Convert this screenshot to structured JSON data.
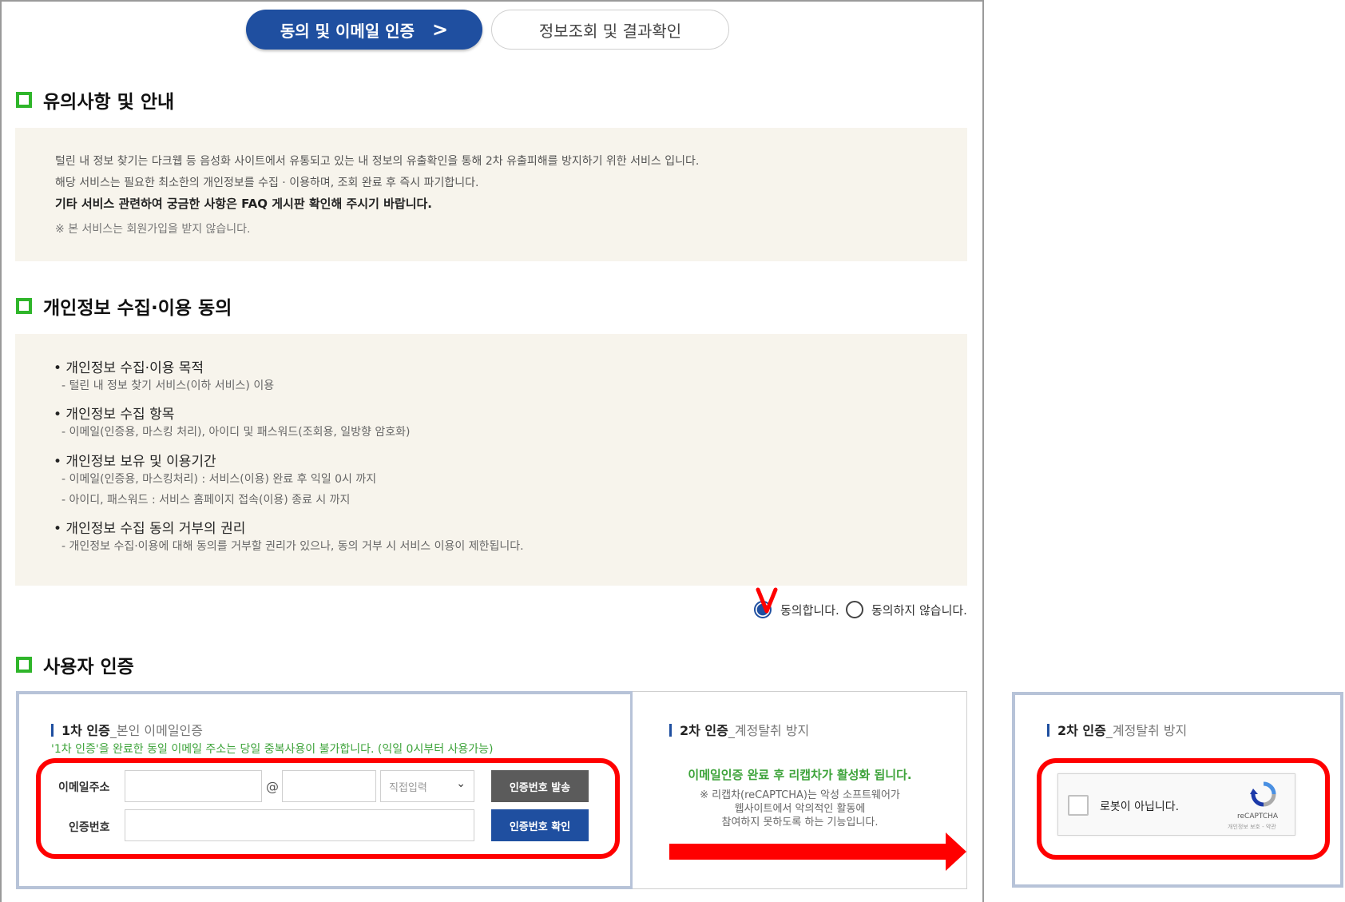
{
  "steps": {
    "active_label": "동의 및 이메일 인증",
    "inactive_label": "정보조회 및 결과확인"
  },
  "notice": {
    "title": "유의사항 및 안내",
    "line1": "털린 내 정보 찾기는 다크웹 등 음성화 사이트에서 유통되고 있는 내 정보의 유출확인을 통해 2차 유출피해를 방지하기 위한 서비스 입니다.",
    "line2": "해당 서비스는 필요한 최소한의 개인정보를 수집 · 이용하며, 조회 완료 후 즉시 파기합니다.",
    "line3": "기타 서비스 관련하여 궁금한 사항은 FAQ 게시판 확인해 주시기 바랍니다.",
    "line4": "※ 본 서비스는 회원가입을 받지 않습니다."
  },
  "privacy": {
    "title": "개인정보 수집·이용 동의",
    "items": [
      {
        "title": "• 개인정보 수집·이용 목적",
        "subs": [
          "- 털린 내 정보 찾기 서비스(이하 서비스) 이용"
        ]
      },
      {
        "title": "• 개인정보 수집 항목",
        "subs": [
          "- 이메일(인증용, 마스킹 처리), 아이디 및 패스워드(조회용, 일방향 암호화)"
        ]
      },
      {
        "title": "• 개인정보 보유 및 이용기간",
        "subs": [
          "- 이메일(인증용, 마스킹처리) : 서비스(이용) 완료 후 익일 0시 까지",
          "- 아이디, 패스워드 : 서비스 홈페이지 접속(이용) 종료 시 까지"
        ]
      },
      {
        "title": "• 개인정보 수집 동의 거부의 권리",
        "subs": [
          "- 개인정보 수집·이용에 대해 동의를 거부할 권리가 있으나, 동의 거부 시 서비스 이용이 제한됩니다."
        ]
      }
    ],
    "agree_label": "동의합니다.",
    "disagree_label": "동의하지 않습니다.",
    "selected": "agree"
  },
  "auth": {
    "title": "사용자 인증",
    "first": {
      "head_bold": "1차 인증",
      "head_light": "_본인 이메일인증",
      "note": "'1차 인증'을 완료한 동일 이메일 주소는 당일 중복사용이 불가합니다. (익일 0시부터 사용가능)",
      "email_label": "이메일주소",
      "at": "@",
      "email_user_value": "",
      "email_domain_value": "",
      "domain_select": "직접입력",
      "send_button": "인증번호 발송",
      "code_label": "인증번호",
      "code_value": "",
      "confirm_button": "인증번호 확인"
    },
    "second": {
      "head_bold": "2차 인증",
      "head_light": "_계정탈취 방지",
      "msg_green": "이메일인증 완료 후 리캡차가 활성화 됩니다.",
      "msg_line1": "※ 리캡차(reCAPTCHA)는 악성 소프트웨어가",
      "msg_line2": "웹사이트에서 악의적인 활동에",
      "msg_line3": "참여하지 못하도록 하는 기능입니다."
    }
  },
  "right_panel": {
    "head_bold": "2차 인증",
    "head_light": "_계정탈취 방지",
    "recaptcha_label": "로봇이 아닙니다.",
    "recaptcha_brand": "reCAPTCHA",
    "recaptcha_terms": "개인정보 보호 - 약관"
  },
  "colors": {
    "brand_blue": "#1f4fa0",
    "section_green": "#2fb52a",
    "note_green": "#3da33a",
    "highlight_red": "#ff0000",
    "panel_bg": "#f7f4ec"
  }
}
